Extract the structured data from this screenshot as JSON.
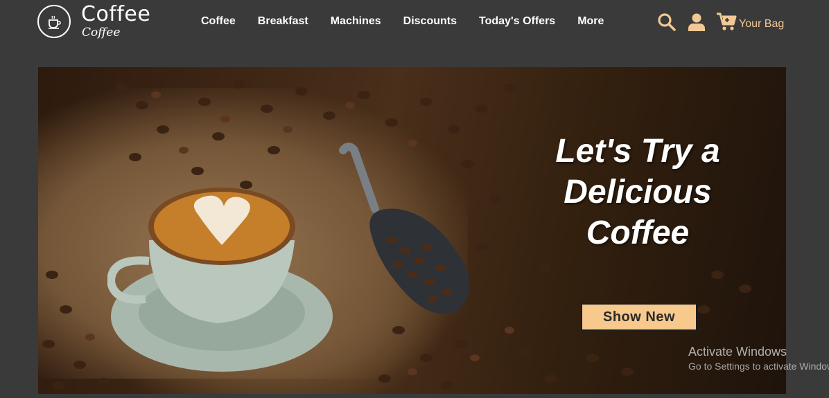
{
  "brand": {
    "name": "Coffee",
    "tagline": "Coffee"
  },
  "nav": {
    "items": [
      {
        "label": "Coffee"
      },
      {
        "label": "Breakfast"
      },
      {
        "label": "Machines"
      },
      {
        "label": "Discounts"
      },
      {
        "label": "Today's Offers"
      },
      {
        "label": "More"
      }
    ]
  },
  "tools": {
    "search_icon": "search-icon",
    "user_icon": "user-icon",
    "cart_icon": "cart-icon",
    "bag_label": "Your Bag"
  },
  "hero": {
    "headline": "Let's Try a Delicious Coffee",
    "button_label": "Show New"
  },
  "watermark": {
    "title": "Activate Windows",
    "subtitle": "Go to Settings to activate Windows."
  },
  "colors": {
    "background": "#3a3a3a",
    "accent": "#f2c894",
    "button_bg": "#f7c98c"
  }
}
